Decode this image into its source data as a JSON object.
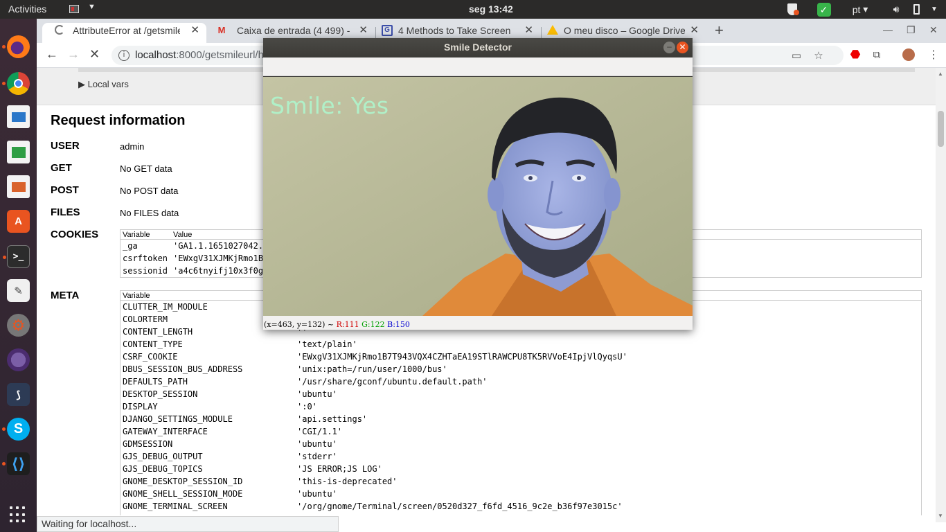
{
  "topbar": {
    "activities": "Activities",
    "clock": "seg 13:42",
    "language": "pt",
    "check_icon": "✓"
  },
  "browser": {
    "tabs": [
      {
        "title": "AttributeError at /getsmileurl/",
        "icon": "loading-spinner"
      },
      {
        "title": "Caixa de entrada (4 499) - ",
        "icon": "gmail-icon"
      },
      {
        "title": "4 Methods to Take Screen",
        "icon": "page-icon"
      },
      {
        "title": "O meu disco – Google Drive",
        "icon": "drive-icon"
      }
    ],
    "url_host": "localhost",
    "url_rest": ":8000/getsmileurl/h",
    "status": "Waiting for localhost..."
  },
  "debug_page": {
    "local_vars": "▶ Local vars",
    "section_title": "Request information",
    "user_label": "USER",
    "user_value": "admin",
    "get_label": "GET",
    "get_value": "No GET data",
    "post_label": "POST",
    "post_value": "No POST data",
    "files_label": "FILES",
    "files_value": "No FILES data",
    "cookies_label": "COOKIES",
    "cookies_header": {
      "variable": "Variable",
      "value": "Value"
    },
    "cookies": [
      {
        "name": "_ga",
        "value": "'GA1.1.1651027042."
      },
      {
        "name": "csrftoken",
        "value": "'EWxgV31XJMKjRmo1B"
      },
      {
        "name": "sessionid",
        "value": "'a4c6tnyifj10x3f0g"
      }
    ],
    "meta_label": "META",
    "meta_header": {
      "variable": "Variable"
    },
    "meta": [
      {
        "name": "CLUTTER_IM_MODULE",
        "value": ""
      },
      {
        "name": "COLORTERM",
        "value": ""
      },
      {
        "name": "CONTENT_LENGTH",
        "value": "''"
      },
      {
        "name": "CONTENT_TYPE",
        "value": "'text/plain'"
      },
      {
        "name": "CSRF_COOKIE",
        "value": "'EWxgV31XJMKjRmo1B7T943VQX4CZHTaEA19STlRAWCPU8TK5RVVoE4IpjVlQyqsU'"
      },
      {
        "name": "DBUS_SESSION_BUS_ADDRESS",
        "value": "'unix:path=/run/user/1000/bus'"
      },
      {
        "name": "DEFAULTS_PATH",
        "value": "'/usr/share/gconf/ubuntu.default.path'"
      },
      {
        "name": "DESKTOP_SESSION",
        "value": "'ubuntu'"
      },
      {
        "name": "DISPLAY",
        "value": "':0'"
      },
      {
        "name": "DJANGO_SETTINGS_MODULE",
        "value": "'api.settings'"
      },
      {
        "name": "GATEWAY_INTERFACE",
        "value": "'CGI/1.1'"
      },
      {
        "name": "GDMSESSION",
        "value": "'ubuntu'"
      },
      {
        "name": "GJS_DEBUG_OUTPUT",
        "value": "'stderr'"
      },
      {
        "name": "GJS_DEBUG_TOPICS",
        "value": "'JS ERROR;JS LOG'"
      },
      {
        "name": "GNOME_DESKTOP_SESSION_ID",
        "value": "'this-is-deprecated'"
      },
      {
        "name": "GNOME_SHELL_SESSION_MODE",
        "value": "'ubuntu'"
      },
      {
        "name": "GNOME_TERMINAL_SCREEN",
        "value": "'/org/gnome/Terminal/screen/0520d327_f6fd_4516_9c2e_b36f97e3015c'"
      }
    ]
  },
  "cv_window": {
    "title": "Smile Detector",
    "overlay_text": "Smile: Yes",
    "status_coords": "(x=463, y=132) ~",
    "status_r": "R:111",
    "status_g": "G:122",
    "status_b": "B:150"
  },
  "colors": {
    "ubuntu_orange": "#e95420",
    "overlay_text": "#b0f0c8",
    "launcher_bg": "#3c2b36"
  }
}
